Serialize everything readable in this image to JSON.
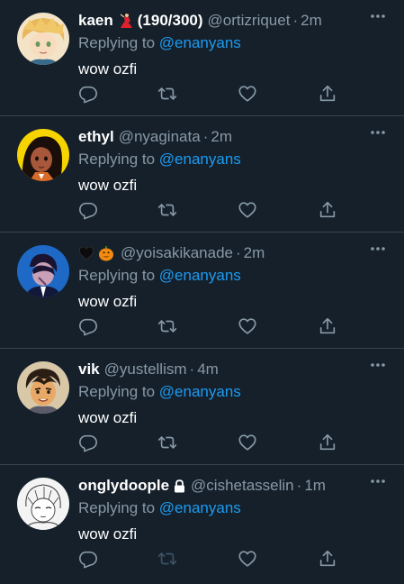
{
  "colors": {
    "background": "#15202b",
    "divider": "#38444d",
    "secondary_text": "#8899a6",
    "mention": "#1d9bf0",
    "primary_text": "#ffffff"
  },
  "tweets": [
    {
      "name": "kaen",
      "name_suffix": "(190/300)",
      "handle": "@ortizriquet",
      "dot": "·",
      "time": "2m",
      "replying_label": "Replying to",
      "replying_to": "@enanyans",
      "text": "wow ozfi",
      "badge_icon": "dancer-emoji-icon",
      "retweet_disabled": false
    },
    {
      "name": "ethyl",
      "handle": "@nyaginata",
      "dot": "·",
      "time": "2m",
      "replying_label": "Replying to",
      "replying_to": "@enanyans",
      "text": "wow ozfi",
      "retweet_disabled": false
    },
    {
      "name": "",
      "name_icons": [
        "black-heart-emoji-icon",
        "pumpkin-emoji-icon"
      ],
      "handle": "@yoisakikanade",
      "dot": "·",
      "time": "2m",
      "replying_label": "Replying to",
      "replying_to": "@enanyans",
      "text": "wow ozfi",
      "retweet_disabled": false
    },
    {
      "name": "vik",
      "handle": "@yustellism",
      "dot": "·",
      "time": "4m",
      "replying_label": "Replying to",
      "replying_to": "@enanyans",
      "text": "wow ozfi",
      "retweet_disabled": false
    },
    {
      "name": "onglydoople",
      "handle": "@cishetasselin",
      "dot": "·",
      "time": "1m",
      "replying_label": "Replying to",
      "replying_to": "@enanyans",
      "text": "wow ozfi",
      "protected_icon": "lock-icon",
      "retweet_disabled": true
    }
  ]
}
